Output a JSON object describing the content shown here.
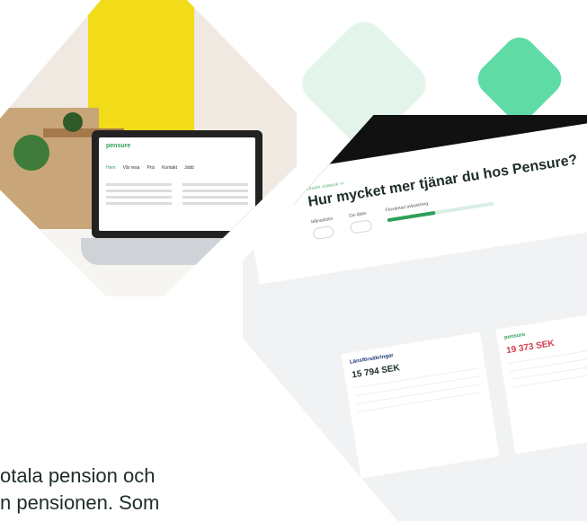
{
  "left_laptop": {
    "logo": "pensure",
    "nav": [
      "Hem",
      "Vår resa",
      "Pris",
      "Kontakt",
      "Jobb"
    ]
  },
  "right_screen": {
    "eyebrow": "SÅHÄR JOBBAR VI",
    "title": "Hur mycket mer tjänar du hos Pensure?",
    "labels": [
      "Månadslön",
      "Din ålder",
      "Förväntad avkastning"
    ],
    "card_left_brand": "Länsförsäkringar",
    "card_left_value": "15 794 SEK",
    "card_right_brand": "pensure",
    "card_right_value": "19 373 SEK"
  },
  "body_text": {
    "line1": "otala pension och",
    "line2": "n pensionen. Som"
  },
  "colors": {
    "accent": "#5fdca6",
    "accent_light": "#e3f5ea",
    "text": "#1e2d2a"
  }
}
